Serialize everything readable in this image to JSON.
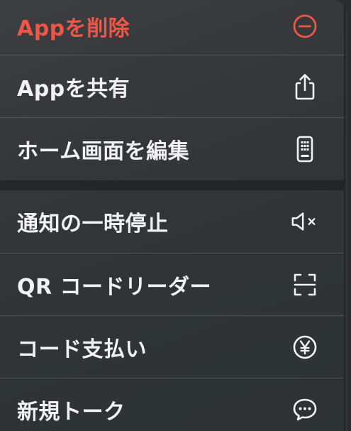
{
  "menu": {
    "items": [
      {
        "label": "Appを削除",
        "icon": "minus-circle-icon",
        "color": "#ee5646"
      },
      {
        "label": "Appを共有",
        "icon": "share-icon"
      },
      {
        "label": "ホーム画面を編集",
        "icon": "phone-icon"
      },
      {
        "label": "通知の一時停止",
        "icon": "speaker-mute-icon"
      },
      {
        "label": "QR コードリーダー",
        "icon": "qr-scan-icon"
      },
      {
        "label": "コード支払い",
        "icon": "yen-circle-icon"
      },
      {
        "label": "新規トーク",
        "icon": "chat-bubble-icon"
      }
    ]
  },
  "colors": {
    "destructive": "#ee5646",
    "text": "#f2f2f4",
    "icon": "#f2f2f4"
  }
}
